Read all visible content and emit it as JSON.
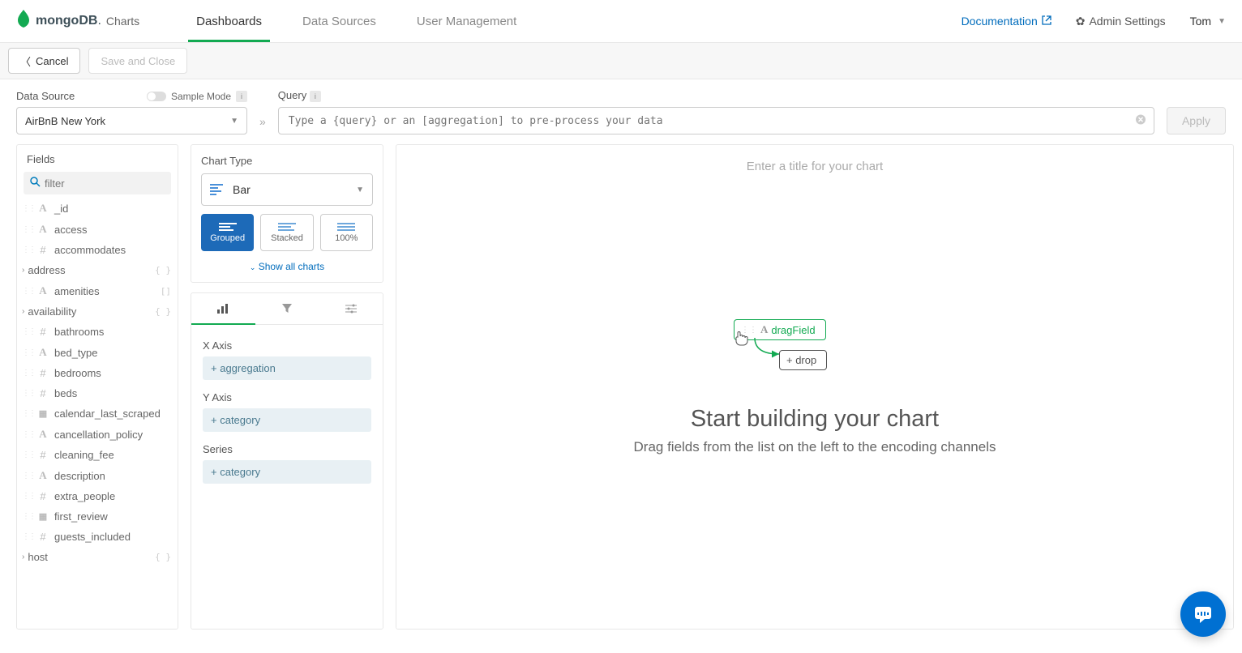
{
  "header": {
    "logo_main": "mongoDB",
    "logo_sub": "Charts",
    "nav": [
      "Dashboards",
      "Data Sources",
      "User Management"
    ],
    "active_nav": 0,
    "doc_link": "Documentation",
    "admin": "Admin Settings",
    "user": "Tom"
  },
  "toolbar": {
    "cancel": "Cancel",
    "save": "Save and Close"
  },
  "config": {
    "ds_label": "Data Source",
    "sample_label": "Sample Mode",
    "ds_value": "AirBnB New York",
    "query_label": "Query",
    "query_placeholder": "Type a {query} or an [aggregation] to pre-process your data",
    "apply": "Apply"
  },
  "fields": {
    "title": "Fields",
    "filter_placeholder": "filter",
    "items": [
      {
        "name": "_id",
        "type": "A"
      },
      {
        "name": "access",
        "type": "A"
      },
      {
        "name": "accommodates",
        "type": "#"
      },
      {
        "name": "address",
        "type": "obj",
        "expandable": true
      },
      {
        "name": "amenities",
        "type": "A",
        "trail": "[]"
      },
      {
        "name": "availability",
        "type": "obj",
        "expandable": true
      },
      {
        "name": "bathrooms",
        "type": "#"
      },
      {
        "name": "bed_type",
        "type": "A"
      },
      {
        "name": "bedrooms",
        "type": "#"
      },
      {
        "name": "beds",
        "type": "#"
      },
      {
        "name": "calendar_last_scraped",
        "type": "cal"
      },
      {
        "name": "cancellation_policy",
        "type": "A"
      },
      {
        "name": "cleaning_fee",
        "type": "#"
      },
      {
        "name": "description",
        "type": "A"
      },
      {
        "name": "extra_people",
        "type": "#"
      },
      {
        "name": "first_review",
        "type": "cal"
      },
      {
        "name": "guests_included",
        "type": "#"
      },
      {
        "name": "host",
        "type": "obj",
        "expandable": true
      }
    ]
  },
  "chart_type": {
    "label": "Chart Type",
    "selected": "Bar",
    "subtypes": [
      "Grouped",
      "Stacked",
      "100%"
    ],
    "active_subtype": 0,
    "show_all": "Show all charts"
  },
  "encoding": {
    "x_label": "X Axis",
    "x_hint": "aggregation",
    "y_label": "Y Axis",
    "y_hint": "category",
    "series_label": "Series",
    "series_hint": "category"
  },
  "canvas": {
    "title_placeholder": "Enter a title for your chart",
    "drag_label": "dragField",
    "drop_label": "+ drop",
    "empty_h1": "Start building your chart",
    "empty_p": "Drag fields from the list on the left to the encoding channels"
  }
}
